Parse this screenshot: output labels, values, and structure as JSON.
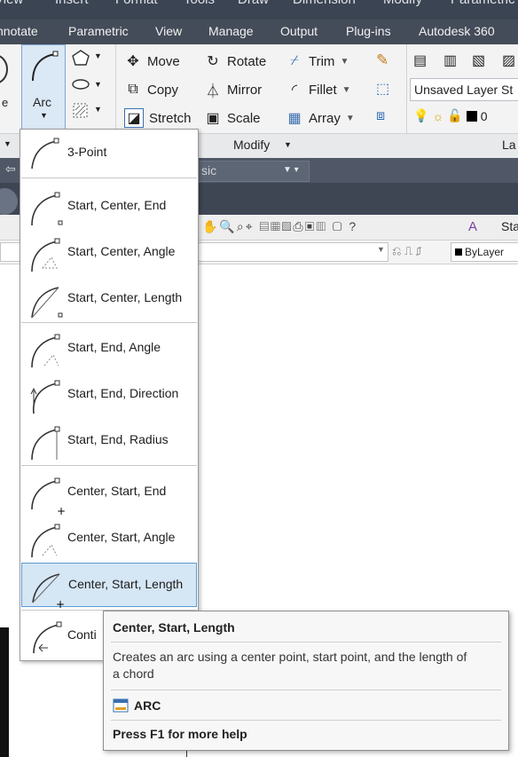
{
  "menubar": [
    "View",
    "Insert",
    "Format",
    "Tools",
    "Draw",
    "Dimension",
    "Modify",
    "Parametric"
  ],
  "ribbon_tabs": [
    "nnotate",
    "Parametric",
    "View",
    "Manage",
    "Output",
    "Plug-ins",
    "Autodesk 360"
  ],
  "arc_button_label": "Arc",
  "modify_tools": {
    "move": "Move",
    "rotate": "Rotate",
    "trim": "Trim",
    "copy": "Copy",
    "mirror": "Mirror",
    "fillet": "Fillet",
    "stretch": "Stretch",
    "scale": "Scale",
    "array": "Array"
  },
  "modify_panel_label": "Modify",
  "layer_state": "Unsaved Layer St",
  "layer_number": "0",
  "layers_panel_label": "La",
  "sic_fragment": "sic",
  "toolbar_fragment": "Sta",
  "bylayer_label": "ByLayer",
  "arc_menu": [
    {
      "label": "3-Point",
      "icon": "arc-3point-icon"
    },
    {
      "label": "Start, Center, End",
      "icon": "arc-start-center-end-icon"
    },
    {
      "label": "Start, Center, Angle",
      "icon": "arc-start-center-angle-icon"
    },
    {
      "label": "Start, Center, Length",
      "icon": "arc-start-center-length-icon"
    },
    {
      "label": "Start, End, Angle",
      "icon": "arc-start-end-angle-icon"
    },
    {
      "label": "Start, End, Direction",
      "icon": "arc-start-end-direction-icon"
    },
    {
      "label": "Start, End, Radius",
      "icon": "arc-start-end-radius-icon"
    },
    {
      "label": "Center, Start, End",
      "icon": "arc-center-start-end-icon"
    },
    {
      "label": "Center, Start, Angle",
      "icon": "arc-center-start-angle-icon"
    },
    {
      "label": "Center, Start, Length",
      "icon": "arc-center-start-length-icon",
      "selected": true
    },
    {
      "label": "Conti",
      "icon": "arc-continue-icon"
    }
  ],
  "tooltip": {
    "title": "Center, Start, Length",
    "description_line1": "Creates an arc using a center point, start point, and the length of",
    "description_line2": "a chord",
    "command": "ARC",
    "help": "Press F1 for more help"
  },
  "colors": {
    "accent_selected": "#d5e6f5",
    "selected_border": "#5b9bd5",
    "ribbon_dark": "#444c59"
  }
}
